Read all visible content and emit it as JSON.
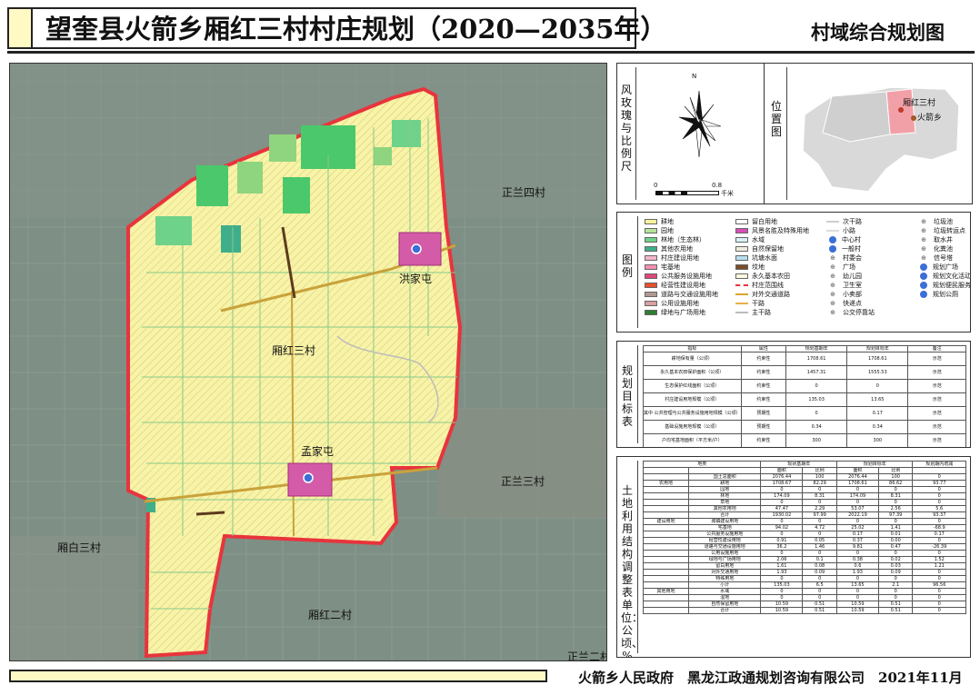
{
  "title": "望奎县火箭乡厢红三村村庄规划（2020—2035年）",
  "subtitle": "村域综合规划图",
  "map": {
    "places": [
      {
        "id": "zl4",
        "label": "正兰四村"
      },
      {
        "id": "hjt",
        "label": "洪家屯"
      },
      {
        "id": "xh3",
        "label": "厢红三村"
      },
      {
        "id": "mjt",
        "label": "孟家屯"
      },
      {
        "id": "zl3",
        "label": "正兰三村"
      },
      {
        "id": "xb3",
        "label": "厢白三村"
      },
      {
        "id": "xh2",
        "label": "厢红二村"
      },
      {
        "id": "zl2",
        "label": "正兰二村"
      }
    ],
    "colors": {
      "farmland": "#f7f3a8",
      "garden": "#8fd47f",
      "forest": "#4bc86b",
      "boundary": "#e8343c",
      "village": "#d45ba8",
      "road": "#c9a23a",
      "imagery": "#7e8f85"
    }
  },
  "compass": {
    "side_label": "风玫瑰与比例尺",
    "north": "N",
    "scale_start": "0",
    "scale_end": "0.8",
    "scale_unit": "千米"
  },
  "location": {
    "side_label": "位置图",
    "village": "厢红三村",
    "township": "火箭乡"
  },
  "legend": {
    "side_label": "图例",
    "items": [
      {
        "label": "耕地",
        "kind": "fill",
        "color": "#f9f39a"
      },
      {
        "label": "园地",
        "kind": "fill",
        "color": "#b7e39a"
      },
      {
        "label": "林地（生态林）",
        "kind": "fill",
        "color": "#6fd28a"
      },
      {
        "label": "其他农用地",
        "kind": "fill",
        "color": "#3fae8a"
      },
      {
        "label": "村庄建设用地",
        "kind": "fill",
        "color": "#f2b6c9"
      },
      {
        "label": "宅基地",
        "kind": "fill",
        "color": "#f58fb0"
      },
      {
        "label": "公共服务设施用地",
        "kind": "fill",
        "color": "#e0467a"
      },
      {
        "label": "经营性建设用地",
        "kind": "fill",
        "color": "#e8502e"
      },
      {
        "label": "道路与交通设施用地",
        "kind": "fill",
        "color": "#b09a90"
      },
      {
        "label": "公用设施用地",
        "kind": "fill",
        "color": "#d8a0a0"
      },
      {
        "label": "绿地与广场用地",
        "kind": "fill",
        "color": "#2e7d32"
      },
      {
        "label": "留白用地",
        "kind": "fill",
        "color": "#ffffff"
      },
      {
        "label": "风景名胜及特殊用地",
        "kind": "fill",
        "color": "#d64fb8"
      },
      {
        "label": "水域",
        "kind": "fill",
        "color": "#d8f0f5"
      },
      {
        "label": "自然保留地",
        "kind": "fill",
        "color": "#f0ece0"
      },
      {
        "label": "坑塘水面",
        "kind": "fill",
        "color": "#b8dff0"
      },
      {
        "label": "坟地",
        "kind": "fill",
        "color": "#7a4e2a"
      },
      {
        "label": "永久基本农田",
        "kind": "fill",
        "color": "#fffbe0"
      },
      {
        "label": "村庄范围线",
        "kind": "line",
        "color": "#e8343c"
      },
      {
        "label": "对外交通道路",
        "kind": "line",
        "color": "#d9a430"
      },
      {
        "label": "干路",
        "kind": "line",
        "color": "#e9b14a"
      },
      {
        "label": "主干路",
        "kind": "line",
        "color": "#bbbbbb"
      },
      {
        "label": "次干路",
        "kind": "line",
        "color": "#cfcfcf"
      },
      {
        "label": "小路",
        "kind": "line",
        "color": "#dddddd"
      },
      {
        "label": "中心村",
        "kind": "dot",
        "color": "#3b6fd8"
      },
      {
        "label": "一般村",
        "kind": "dot",
        "color": "#3b6fd8"
      },
      {
        "label": "村委会",
        "kind": "sym",
        "color": "#555555"
      },
      {
        "label": "广场",
        "kind": "sym",
        "color": "#555555"
      },
      {
        "label": "幼儿园",
        "kind": "sym",
        "color": "#555555"
      },
      {
        "label": "卫生室",
        "kind": "sym",
        "color": "#555555"
      },
      {
        "label": "小卖部",
        "kind": "sym",
        "color": "#555555"
      },
      {
        "label": "快递点",
        "kind": "sym",
        "color": "#555555"
      },
      {
        "label": "公交停靠站",
        "kind": "sym",
        "color": "#555555"
      },
      {
        "label": "垃圾池",
        "kind": "sym",
        "color": "#555555"
      },
      {
        "label": "垃圾转运点",
        "kind": "sym",
        "color": "#555555"
      },
      {
        "label": "取水井",
        "kind": "sym",
        "color": "#555555"
      },
      {
        "label": "化粪池",
        "kind": "sym",
        "color": "#555555"
      },
      {
        "label": "信号塔",
        "kind": "sym",
        "color": "#555555"
      },
      {
        "label": "规划广场",
        "kind": "dot",
        "color": "#3b6fd8"
      },
      {
        "label": "规划文化活动站",
        "kind": "dot",
        "color": "#3b6fd8"
      },
      {
        "label": "规划便民服务中心",
        "kind": "dot",
        "color": "#3b6fd8"
      },
      {
        "label": "规划公厕",
        "kind": "dot",
        "color": "#3b6fd8"
      }
    ]
  },
  "targets": {
    "side_label": "规划目标表",
    "headers": [
      "指标",
      "属性",
      "规划基期年",
      "规划目标年",
      "备注"
    ],
    "rows": [
      [
        "耕地保有量（公顷）",
        "约束性",
        "1708.61",
        "1708.61",
        "示范"
      ],
      [
        "永久基本农田保护面积（公顷）",
        "约束性",
        "1457.31",
        "1555.53",
        "示范"
      ],
      [
        "生态保护红线面积（公顷）",
        "约束性",
        "0",
        "0",
        "示范"
      ],
      [
        "村庄建设用地规模（公顷）",
        "约束性",
        "135.03",
        "13.65",
        "示范"
      ],
      [
        "其中",
        "公共管理与公共服务设施用地规模（公顷）",
        "预期性",
        "0",
        "0.17",
        "示范"
      ],
      [
        "",
        "基础设施用地规模（公顷）",
        "预期性",
        "0.34",
        "0.34",
        "示范"
      ],
      [
        "户均宅基地面积（平方米/户）",
        "约束性",
        "300",
        "300",
        "示范"
      ]
    ]
  },
  "landuse": {
    "side_label": "土地利用结构调整表单位：公顷、%",
    "headers": [
      "地类",
      "现状基期年",
      "规划目标年",
      "规划期内增减"
    ],
    "subheaders": [
      "面积",
      "比例",
      "面积",
      "比例"
    ],
    "rows": [
      [
        "",
        "国土总面积",
        "2076.44",
        "100",
        "2076.44",
        "100",
        "0"
      ],
      [
        "农用地",
        "耕地",
        "1708.67",
        "82.29",
        "1708.61",
        "86.62",
        "93.77"
      ],
      [
        "",
        "园地",
        "0",
        "0",
        "0",
        "0",
        "0"
      ],
      [
        "",
        "林地",
        "174.09",
        "8.31",
        "174.09",
        "8.31",
        "0"
      ],
      [
        "",
        "草地",
        "0",
        "0",
        "0",
        "0",
        "0"
      ],
      [
        "",
        "其他农用地",
        "47.47",
        "2.29",
        "53.07",
        "2.56",
        "5.6"
      ],
      [
        "",
        "合计",
        "1930.02",
        "97.99",
        "2022.19",
        "97.39",
        "93.37"
      ],
      [
        "建设用地",
        "城镇建设用地",
        "0",
        "0",
        "0",
        "0",
        "0"
      ],
      [
        "",
        "宅基地",
        "94.02",
        "4.72",
        "25.02",
        "1.41",
        "-68.9"
      ],
      [
        "",
        "公共服务设施用地",
        "0",
        "0",
        "0.17",
        "0.01",
        "0.17"
      ],
      [
        "",
        "经营性建设用地",
        "0.91",
        "0.05",
        "0.37",
        "0.00",
        "0"
      ],
      [
        "",
        "道路与交通设施用地",
        "36.2",
        "1.46",
        "9.81",
        "0.47",
        "-26.39"
      ],
      [
        "",
        "公用设施用地",
        "0",
        "0",
        "0",
        "0",
        "0"
      ],
      [
        "",
        "绿地与广场用地",
        "2.06",
        "0.1",
        "0.38",
        "0.02",
        "1.52"
      ],
      [
        "",
        "留白用地",
        "1.61",
        "0.08",
        "0.6",
        "0.03",
        "1.21"
      ],
      [
        "",
        "对外交通用地",
        "1.93",
        "0.09",
        "1.93",
        "0.09",
        "0"
      ],
      [
        "",
        "特殊用地",
        "0",
        "0",
        "0",
        "0",
        "0"
      ],
      [
        "",
        "小计",
        "135.03",
        "6.5",
        "13.65",
        "2.1",
        "96.56"
      ],
      [
        "其他用地",
        "水域",
        "0",
        "0",
        "0",
        "0",
        "0"
      ],
      [
        "",
        "湿地",
        "0",
        "0",
        "0",
        "0",
        "0"
      ],
      [
        "",
        "自然保留用地",
        "10.59",
        "0.51",
        "10.59",
        "0.51",
        "0"
      ],
      [
        "",
        "合计",
        "10.59",
        "0.51",
        "10.59",
        "0.51",
        "0"
      ]
    ]
  },
  "footer": "火箭乡人民政府　黑龙江政通规划咨询有限公司　2021年11月"
}
